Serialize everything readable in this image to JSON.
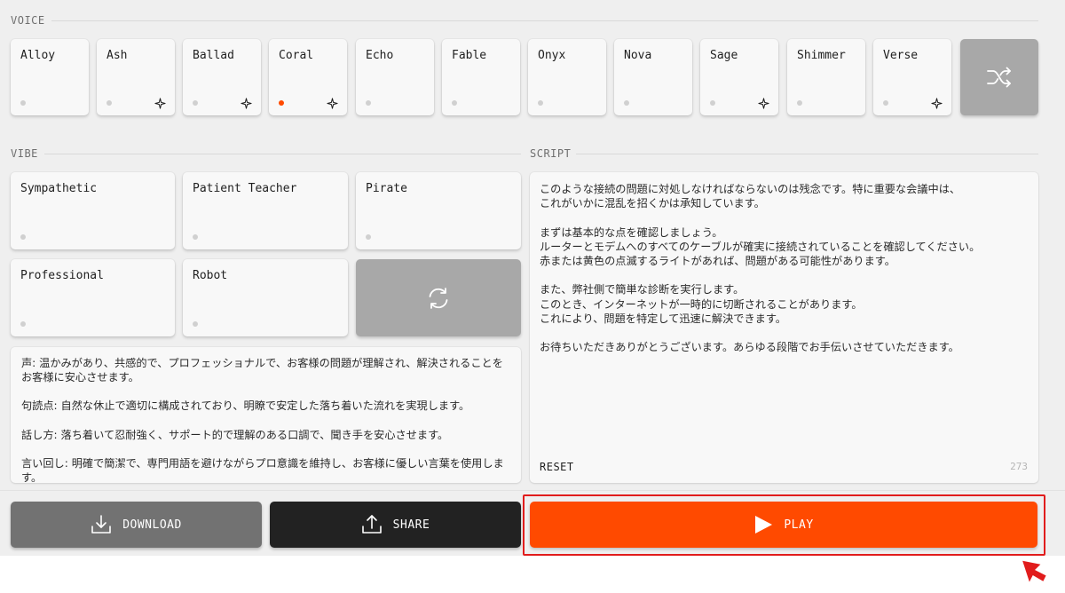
{
  "voice": {
    "label": "VOICE",
    "items": [
      {
        "name": "Alloy",
        "active": false,
        "spark": false
      },
      {
        "name": "Ash",
        "active": false,
        "spark": true
      },
      {
        "name": "Ballad",
        "active": false,
        "spark": true
      },
      {
        "name": "Coral",
        "active": true,
        "spark": true
      },
      {
        "name": "Echo",
        "active": false,
        "spark": false
      },
      {
        "name": "Fable",
        "active": false,
        "spark": false
      },
      {
        "name": "Onyx",
        "active": false,
        "spark": false
      },
      {
        "name": "Nova",
        "active": false,
        "spark": false
      },
      {
        "name": "Sage",
        "active": false,
        "spark": true
      },
      {
        "name": "Shimmer",
        "active": false,
        "spark": false
      },
      {
        "name": "Verse",
        "active": false,
        "spark": true
      }
    ],
    "shuffle_icon": "shuffle-icon"
  },
  "vibe": {
    "label": "VIBE",
    "items": [
      {
        "name": "Sympathetic"
      },
      {
        "name": "Patient Teacher"
      },
      {
        "name": "Pirate"
      },
      {
        "name": "Professional"
      },
      {
        "name": "Robot"
      }
    ],
    "refresh_icon": "refresh-icon",
    "description": [
      "声: 温かみがあり、共感的で、プロフェッショナルで、お客様の問題が理解され、解決されることをお客様に安心させます。",
      "句読点: 自然な休止で適切に構成されており、明瞭で安定した落ち着いた流れを実現します。",
      "話し方: 落ち着いて忍耐強く、サポート的で理解のある口調で、聞き手を安心させます。",
      "言い回し: 明確で簡潔で、専門用語を避けながらプロ意識を維持し、お客様に優しい言葉を使用します。"
    ]
  },
  "script": {
    "label": "SCRIPT",
    "lines": [
      "このような接続の問題に対処しなければならないのは残念です。特に重要な会議中は、",
      "これがいかに混乱を招くかは承知しています。",
      "",
      "まずは基本的な点を確認しましょう。",
      "ルーターとモデムへのすべてのケーブルが確実に接続されていることを確認してください。",
      "赤または黄色の点滅するライトがあれば、問題がある可能性があります。",
      "",
      "また、弊社側で簡単な診断を実行します。",
      "このとき、インターネットが一時的に切断されることがあります。",
      "これにより、問題を特定して迅速に解決できます。",
      "",
      "お待ちいただきありがとうございます。あらゆる段階でお手伝いさせていただきます。"
    ],
    "reset_label": "RESET",
    "char_count": "273"
  },
  "actions": {
    "download_label": "DOWNLOAD",
    "share_label": "SHARE",
    "play_label": "PLAY"
  },
  "colors": {
    "accent": "#ff4a00",
    "highlight": "#e11c1c"
  }
}
